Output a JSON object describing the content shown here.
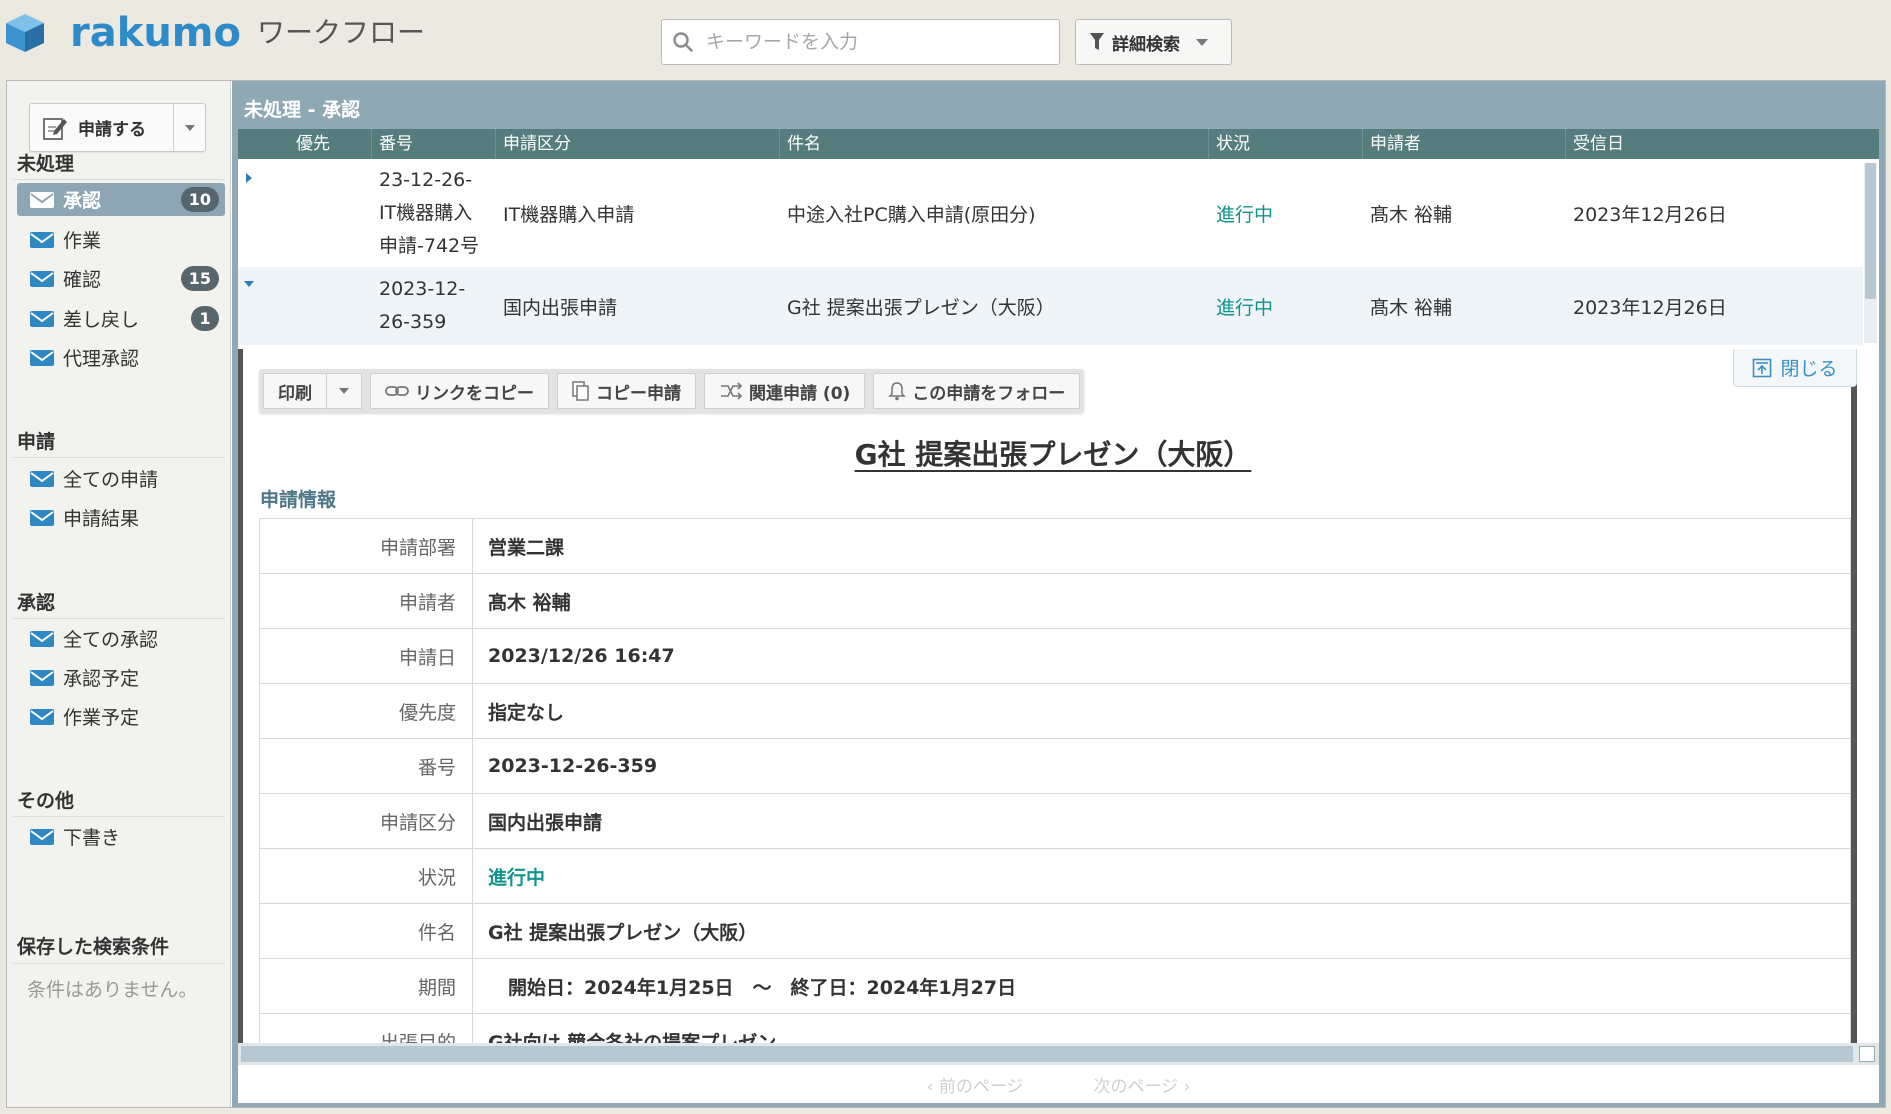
{
  "header": {
    "logo_text": "rakumo",
    "app_name": "ワークフロー",
    "search_placeholder": "キーワードを入力",
    "advanced_search_label": "詳細検索"
  },
  "sidebar": {
    "apply_button": "申請する",
    "sections": [
      {
        "title": "未処理",
        "items": [
          {
            "label": "承認",
            "count": "10",
            "active": true
          },
          {
            "label": "作業"
          },
          {
            "label": "確認",
            "count": "15"
          },
          {
            "label": "差し戻し",
            "count": "1"
          },
          {
            "label": "代理承認"
          }
        ]
      },
      {
        "title": "申請",
        "items": [
          {
            "label": "全ての申請"
          },
          {
            "label": "申請結果"
          }
        ]
      },
      {
        "title": "承認",
        "items": [
          {
            "label": "全ての承認"
          },
          {
            "label": "承認予定"
          },
          {
            "label": "作業予定"
          }
        ]
      },
      {
        "title": "その他",
        "items": [
          {
            "label": "下書き"
          }
        ]
      },
      {
        "title": "保存した検索条件",
        "items": []
      }
    ],
    "saved_search_empty": "条件はありません。"
  },
  "list": {
    "title": "未処理 - 承認",
    "columns": [
      "優先",
      "番号",
      "申請区分",
      "件名",
      "状況",
      "申請者",
      "受信日"
    ],
    "rows": [
      {
        "number": "23-12-26-IT機器購入申請-742号",
        "number_lines": [
          "23-12-26-",
          "IT機器購入",
          "申請-742号"
        ],
        "category": "IT機器購入申請",
        "subject": "中途入社PC購入申請(原田分)",
        "status": "進行中",
        "applicant": "髙木 裕輔",
        "received": "2023年12月26日"
      },
      {
        "number": "2023-12-26-359",
        "number_lines": [
          "2023-12-",
          "26-359"
        ],
        "category": "国内出張申請",
        "subject": "G社 提案出張プレゼン（大阪）",
        "status": "進行中",
        "applicant": "髙木 裕輔",
        "received": "2023年12月26日"
      }
    ]
  },
  "detail": {
    "close_label": "閉じる",
    "toolbar": {
      "print": "印刷",
      "copy_link": "リンクをコピー",
      "copy_apply": "コピー申請",
      "related": "関連申請 (0)",
      "follow": "この申請をフォロー"
    },
    "title": "G社 提案出張プレゼン（大阪）",
    "section_label": "申請情報",
    "fields": [
      {
        "key": "申請部署",
        "value": "営業二課"
      },
      {
        "key": "申請者",
        "value": "髙木 裕輔"
      },
      {
        "key": "申請日",
        "value": "2023/12/26 16:47"
      },
      {
        "key": "優先度",
        "value": "指定なし"
      },
      {
        "key": "番号",
        "value": "2023-12-26-359"
      },
      {
        "key": "申請区分",
        "value": "国内出張申請"
      },
      {
        "key": "状況",
        "value": "進行中"
      },
      {
        "key": "件名",
        "value": "G社 提案出張プレゼン（大阪）"
      },
      {
        "key": "期間",
        "value": "開始日：2024年1月25日　～　終了日：2024年1月27日"
      },
      {
        "key": "出張目的",
        "value": "G社向け 競合各社の提案プレゼン"
      }
    ]
  },
  "pager": {
    "prev": "前のページ",
    "next": "次のページ"
  },
  "colors": {
    "brand": "#2e8bc9",
    "list_header": "#557d7e",
    "pane_bg": "#8ea8b4",
    "status_green": "#13938d"
  }
}
